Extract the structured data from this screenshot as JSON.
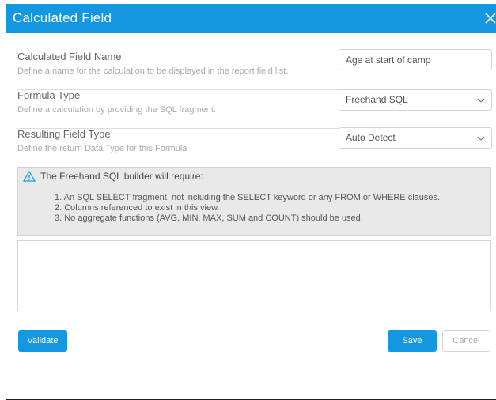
{
  "dialog": {
    "title": "Calculated Field",
    "close_icon": "close-icon"
  },
  "fields": {
    "name": {
      "label": "Calculated Field Name",
      "description": "Define a name for the calculation to be displayed in the report field list.",
      "value": "Age at start of camp"
    },
    "formula_type": {
      "label": "Formula Type",
      "description": "Define a calculation by providing the SQL fragment.",
      "selected": "Freehand SQL"
    },
    "result_type": {
      "label": "Resulting Field Type",
      "description": "Define the return Data Type for this Formula",
      "selected": "Auto Detect"
    }
  },
  "notice": {
    "heading": "The Freehand SQL builder will require:",
    "items": [
      "1. An SQL SELECT fragment, not including the SELECT keyword or any FROM or WHERE clauses.",
      "2. Columns referenced to exist in this view.",
      "3. No aggregate functions (AVG, MIN, MAX, SUM and COUNT) should be used."
    ]
  },
  "sql_editor": {
    "value": ""
  },
  "buttons": {
    "validate": "Validate",
    "save": "Save",
    "cancel": "Cancel"
  },
  "colors": {
    "accent": "#1297e0",
    "notice_bg": "#e9e9e9"
  }
}
